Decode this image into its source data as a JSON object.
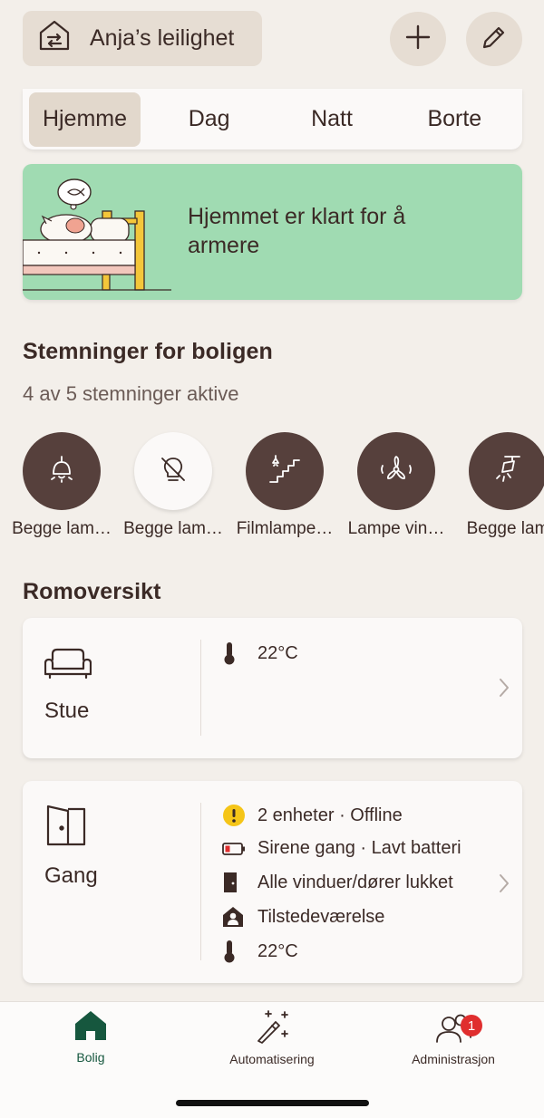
{
  "header": {
    "home_name": "Anja’s leilighet"
  },
  "modes": [
    "Hjemme",
    "Dag",
    "Natt",
    "Borte"
  ],
  "banner": {
    "text": "Hjemmet er klart for å armere"
  },
  "scenes_section": {
    "title": "Stemninger for boligen",
    "subtitle": "4 av 5 stemninger aktive",
    "items": [
      {
        "label": "Begge lam…",
        "icon": "ceiling-lamp-icon",
        "active": true
      },
      {
        "label": "Begge lam…",
        "icon": "bulb-off-icon",
        "active": false
      },
      {
        "label": "Filmlampe…",
        "icon": "stairs-lamp-icon",
        "active": true
      },
      {
        "label": "Lampe vin…",
        "icon": "fan-icon",
        "active": true
      },
      {
        "label": "Begge lam",
        "icon": "spotlight-icon",
        "active": true
      }
    ]
  },
  "rooms_section": {
    "title": "Romoversikt",
    "rooms": [
      {
        "name": "Stue",
        "icon": "sofa-icon",
        "statuses": [
          {
            "icon": "thermometer-icon",
            "text": "22°C"
          }
        ]
      },
      {
        "name": "Gang",
        "icon": "door-icon",
        "statuses": [
          {
            "icon": "warning-icon",
            "text": "2 enheter · Offline"
          },
          {
            "icon": "low-battery-icon",
            "text": "Sirene gang · Lavt batteri"
          },
          {
            "icon": "closed-door-icon",
            "text": "Alle vinduer/dører lukket"
          },
          {
            "icon": "presence-icon",
            "text": "Tilstedeværelse"
          },
          {
            "icon": "thermometer-icon",
            "text": "22°C"
          }
        ]
      }
    ]
  },
  "tabbar": {
    "tabs": [
      {
        "label": "Bolig",
        "icon": "home-icon",
        "active": true
      },
      {
        "label": "Automatisering",
        "icon": "magic-wand-icon",
        "active": false
      },
      {
        "label": "Administrasjon",
        "icon": "users-icon",
        "active": false,
        "badge": "1"
      }
    ]
  },
  "colors": {
    "background": "#f3efea",
    "accent_dark": "#56403c",
    "banner_green": "#a0dbb2",
    "active_tab_green": "#16573e",
    "badge_red": "#e02e2e",
    "warning_yellow": "#f5c518"
  }
}
